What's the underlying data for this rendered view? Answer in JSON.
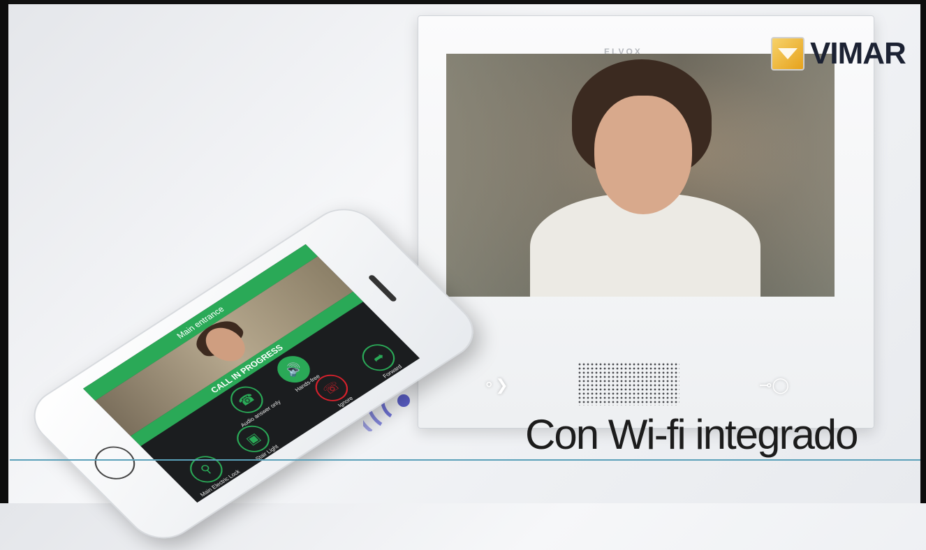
{
  "logo": {
    "brand": "VIMAR"
  },
  "monitor": {
    "brand_mark": "ELVOX"
  },
  "caption": {
    "text": "Con Wi-fi integrado"
  },
  "phone": {
    "header_title": "Main entrance",
    "status": "CALL IN PROGRESS",
    "buttons": [
      {
        "label": "Audio answer only",
        "icon": "phone-icon"
      },
      {
        "label": "Hands-free",
        "icon": "speaker-icon"
      },
      {
        "label": "Main Electric Lock",
        "icon": "key-icon"
      },
      {
        "label": "Stair Light",
        "icon": "light-switch-icon"
      },
      {
        "label": "Ignore",
        "icon": "hangup-icon"
      },
      {
        "label": "Forward",
        "icon": "forward-call-icon"
      }
    ]
  },
  "colors": {
    "accent_green": "#2aa957",
    "hangup_red": "#d7212c",
    "wifi_purple": "#5b5fc7",
    "line_blue": "#5aa0b9"
  }
}
